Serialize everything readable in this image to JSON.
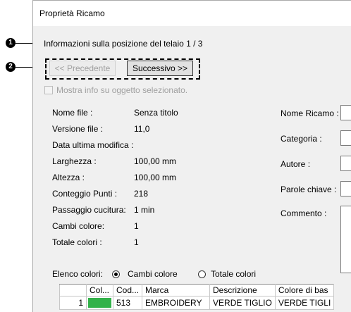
{
  "window": {
    "title": "Proprietà Ricamo"
  },
  "callouts": {
    "one": "1",
    "two": "2"
  },
  "frame_info": "Informazioni sulla posizione del telaio 1 / 3",
  "nav": {
    "prev_label": "<< Precedente",
    "next_label": "Successivo >>"
  },
  "show_selected_info": {
    "label": "Mostra info su oggetto selezionato.",
    "checked": false,
    "enabled": false
  },
  "file_info": [
    {
      "label": "Nome file :",
      "value": "Senza titolo"
    },
    {
      "label": "Versione file :",
      "value": "11,0"
    },
    {
      "label": "Data ultima modifica :",
      "value": ""
    },
    {
      "label": "Larghezza :",
      "value": "100,00 mm"
    },
    {
      "label": "Altezza :",
      "value": "100,00 mm"
    },
    {
      "label": "Conteggio Punti :",
      "value": "218"
    },
    {
      "label": "Passaggio cucitura:",
      "value": "1 min"
    },
    {
      "label": "Cambi colore:",
      "value": "1"
    },
    {
      "label": "Totale colori :",
      "value": "1"
    }
  ],
  "right_fields": {
    "name": "Nome Ricamo :",
    "category": "Categoria :",
    "author": "Autore :",
    "keywords": "Parole chiave :",
    "comment": "Commento :"
  },
  "color_list": {
    "label": "Elenco colori:",
    "options": [
      "Cambi colore",
      "Totale colori"
    ],
    "selected": "Cambi colore"
  },
  "color_table": {
    "headers": [
      "",
      "Col...",
      "Cod...",
      "Marca",
      "Descrizione",
      "Colore di bas"
    ],
    "rows": [
      {
        "index": "1",
        "swatch": "#33b24a",
        "code": "513",
        "brand": "EMBROIDERY",
        "description": "VERDE TIGLIO",
        "base": "VERDE TIGLI"
      }
    ]
  }
}
